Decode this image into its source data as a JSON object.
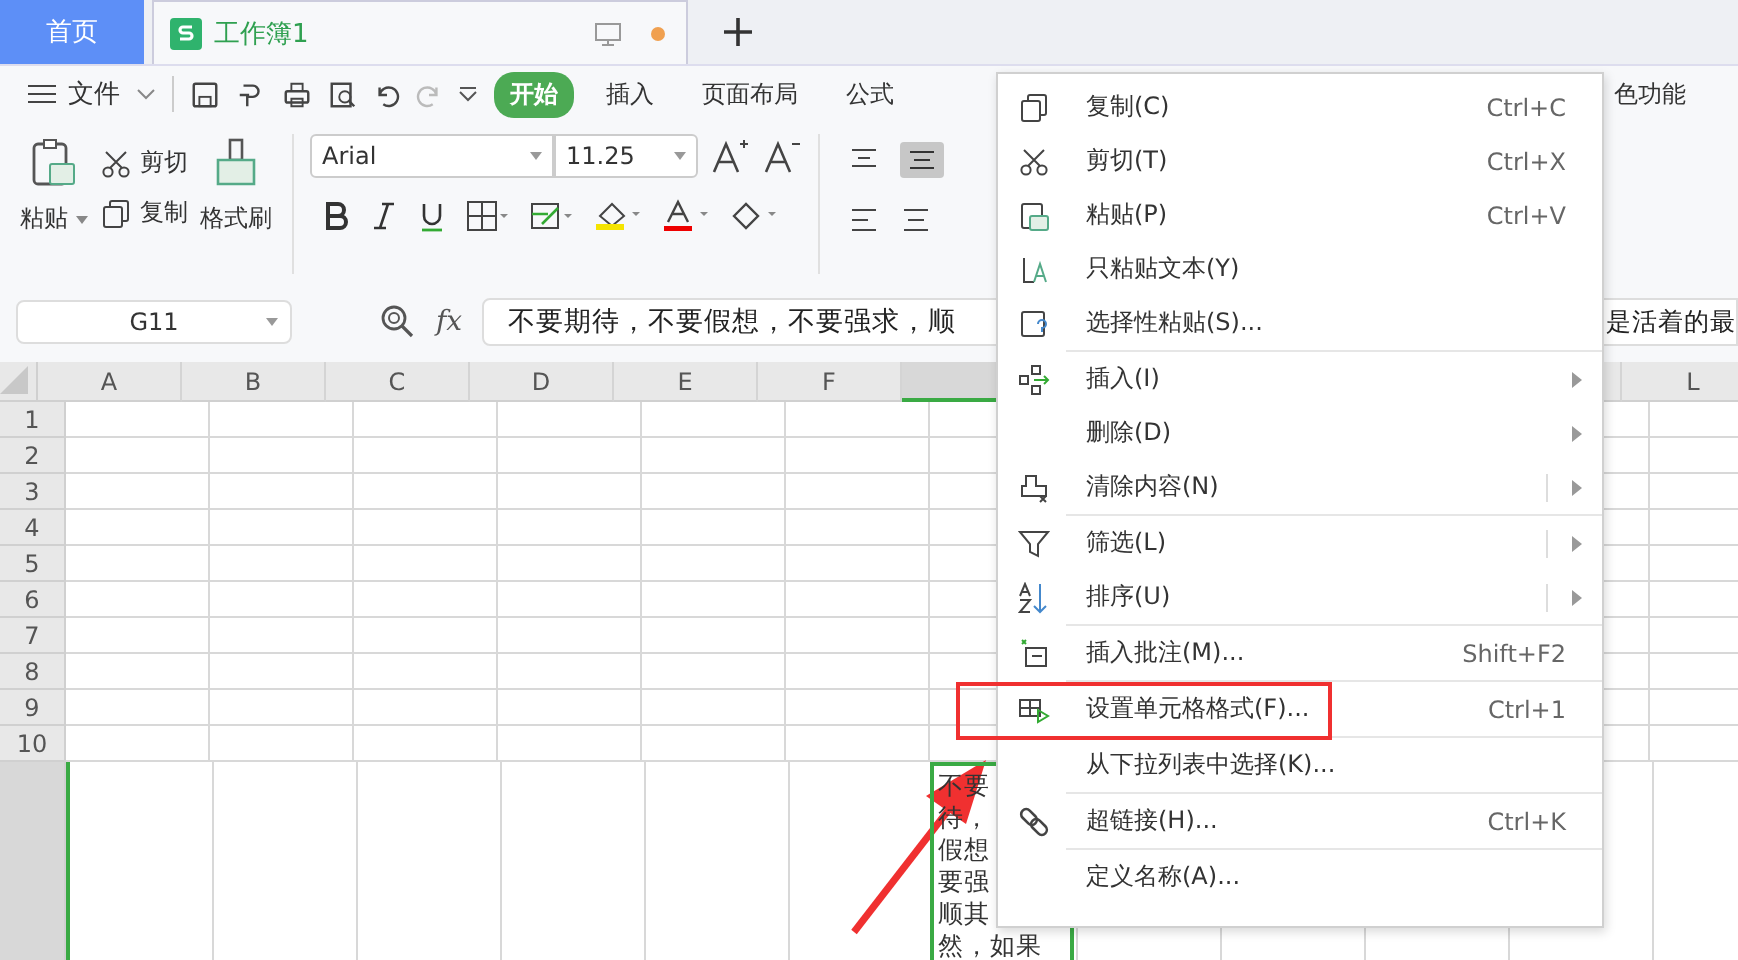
{
  "tabs": [
    {
      "label": "首页",
      "kind": "home",
      "selected": false
    },
    {
      "label": "工作簿1",
      "kind": "doc",
      "selected": true
    }
  ],
  "menu_bar": {
    "file": "文件",
    "items": [
      {
        "label": "开始",
        "selected": true
      },
      {
        "label": "插入",
        "selected": false
      },
      {
        "label": "页面布局",
        "selected": false
      },
      {
        "label": "公式",
        "selected": false
      },
      {
        "label": "色功能",
        "selected": false
      }
    ]
  },
  "ribbon": {
    "paste": "粘贴",
    "cut": "剪切",
    "copy": "复制",
    "format_painter": "格式刷",
    "font": "Arial",
    "font_size": "11.25"
  },
  "formula_bar": {
    "cell_ref": "G11",
    "fx": "fx",
    "text_parts": [
      "不要期待，不要假想，不要强求，顺",
      "是活着的最"
    ]
  },
  "sheet": {
    "columns": [
      {
        "label": "A",
        "selected": false
      },
      {
        "label": "B",
        "selected": false
      },
      {
        "label": "C",
        "selected": false
      },
      {
        "label": "D",
        "selected": false
      },
      {
        "label": "E",
        "selected": false
      },
      {
        "label": "F",
        "selected": false
      }
    ],
    "active_column": {
      "selected": true
    },
    "right_columns": [
      {
        "label": "L",
        "selected": false
      }
    ],
    "rows": [
      "1",
      "2",
      "3",
      "4",
      "5",
      "6",
      "7",
      "8",
      "9",
      "10"
    ],
    "active_cell_lines": [
      "不要",
      "待，",
      "假想",
      "要强",
      "顺其",
      "然，如果"
    ]
  },
  "context_menu": [
    {
      "label": "复制(C)",
      "shortcut": "Ctrl+C",
      "kind": "command",
      "divider_after": false
    },
    {
      "label": "剪切(T)",
      "shortcut": "Ctrl+X",
      "kind": "command",
      "divider_after": false
    },
    {
      "label": "粘贴(P)",
      "shortcut": "Ctrl+V",
      "kind": "command",
      "divider_after": false
    },
    {
      "label": "只粘贴文本(Y)",
      "kind": "command",
      "divider_after": false
    },
    {
      "label": "选择性粘贴(S)...",
      "kind": "command",
      "divider_after": true
    },
    {
      "label": "插入(I)",
      "kind": "submenu",
      "divider_after": false
    },
    {
      "label": "删除(D)",
      "kind": "submenu",
      "divider_after": false
    },
    {
      "label": "清除内容(N)",
      "kind": "split-submenu",
      "divider_after": true
    },
    {
      "label": "筛选(L)",
      "kind": "split-submenu",
      "divider_after": false
    },
    {
      "label": "排序(U)",
      "kind": "split-submenu",
      "divider_after": true
    },
    {
      "label": "插入批注(M)...",
      "shortcut": "Shift+F2",
      "kind": "command",
      "divider_after": true
    },
    {
      "label": "设置单元格格式(F)...",
      "shortcut": "Ctrl+1",
      "kind": "command",
      "divider_after": true
    },
    {
      "label": "从下拉列表中选择(K)...",
      "kind": "command",
      "divider_after": true
    },
    {
      "label": "超链接(H)...",
      "shortcut": "Ctrl+K",
      "kind": "command",
      "divider_after": true
    },
    {
      "label": "定义名称(A)...",
      "kind": "command",
      "divider_after": false
    }
  ]
}
